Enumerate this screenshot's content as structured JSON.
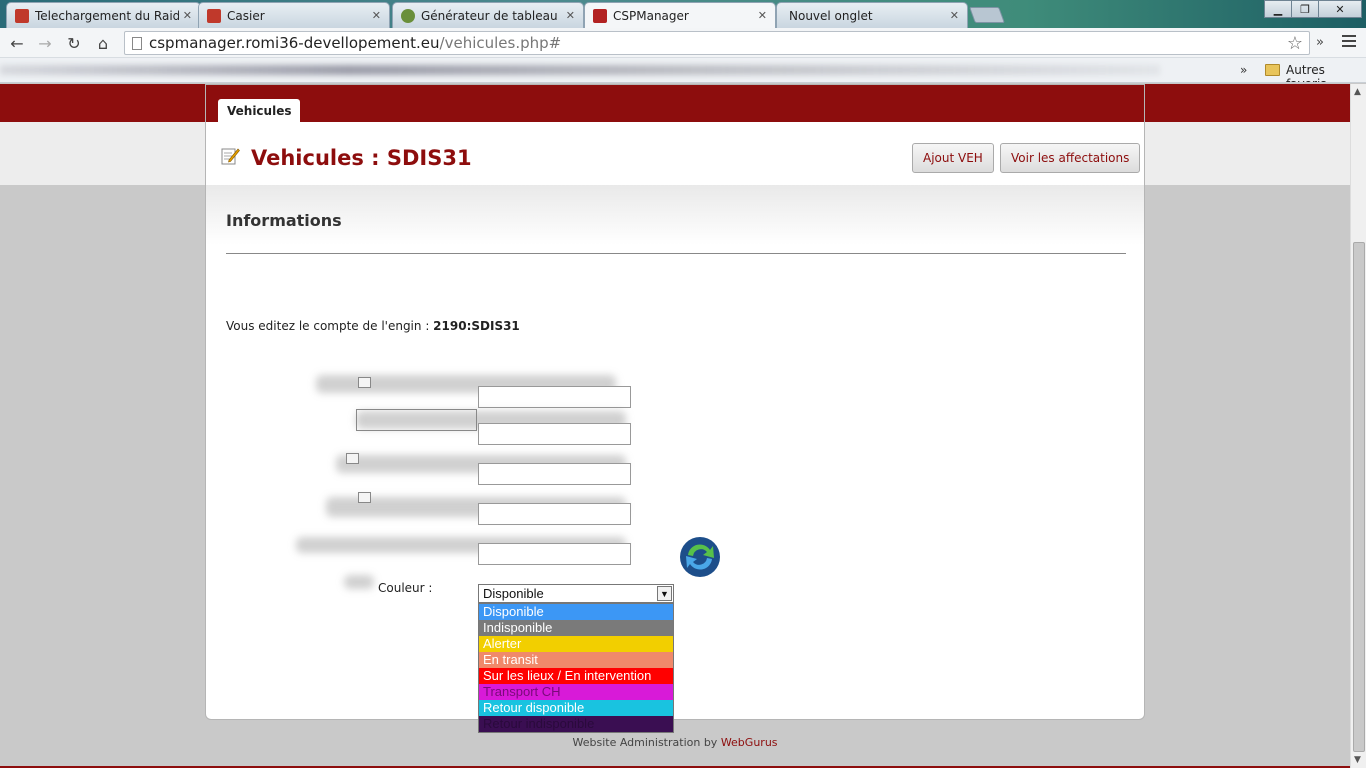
{
  "browser": {
    "tabs": [
      {
        "label": "Telechargement du Raidc",
        "favicon_color": "#c0392b",
        "active": false
      },
      {
        "label": "Casier",
        "favicon_color": "#c0392b",
        "active": false
      },
      {
        "label": "Générateur de tableau",
        "favicon_color": "#6a8f3a",
        "active": false
      },
      {
        "label": "CSPManager",
        "favicon_color": "#b22222",
        "active": true
      },
      {
        "label": "Nouvel onglet",
        "favicon_color": "",
        "active": false
      }
    ],
    "url_host": "cspmanager.romi36-devellopement.eu",
    "url_path": "/vehicules.php#",
    "bookmarks_folder": "Autres favoris"
  },
  "page": {
    "tab_label": "Vehicules",
    "title": "Vehicules : SDIS31",
    "buttons": {
      "add": "Ajout VEH",
      "assignments": "Voir les affectations"
    },
    "section_title": "Informations",
    "info_prefix": "Vous editez le compte de l'engin : ",
    "info_value": "2190:SDIS31",
    "couleur_label": "Couleur :",
    "select_value": "Disponible",
    "options": [
      {
        "label": "Disponible",
        "bg": "#3c97f5",
        "fg": "#ffffff"
      },
      {
        "label": "Indisponible",
        "bg": "#7a7a7a",
        "fg": "#ffffff"
      },
      {
        "label": "Alerter",
        "bg": "#f2cf00",
        "fg": "#ffffff"
      },
      {
        "label": "En transit",
        "bg": "#f0896a",
        "fg": "#ffffff"
      },
      {
        "label": "Sur les lieux / En intervention",
        "bg": "#ff0000",
        "fg": "#ffffff"
      },
      {
        "label": "Transport CH",
        "bg": "#d81ad8",
        "fg": "#7a0a7a"
      },
      {
        "label": "Retour disponible",
        "bg": "#19c3e0",
        "fg": "#ffffff"
      },
      {
        "label": "Retour indisponible",
        "bg": "#3a0e52",
        "fg": "#2a0a3c"
      }
    ],
    "footer_prefix": "Website Administration by ",
    "footer_link": "WebGurus"
  }
}
